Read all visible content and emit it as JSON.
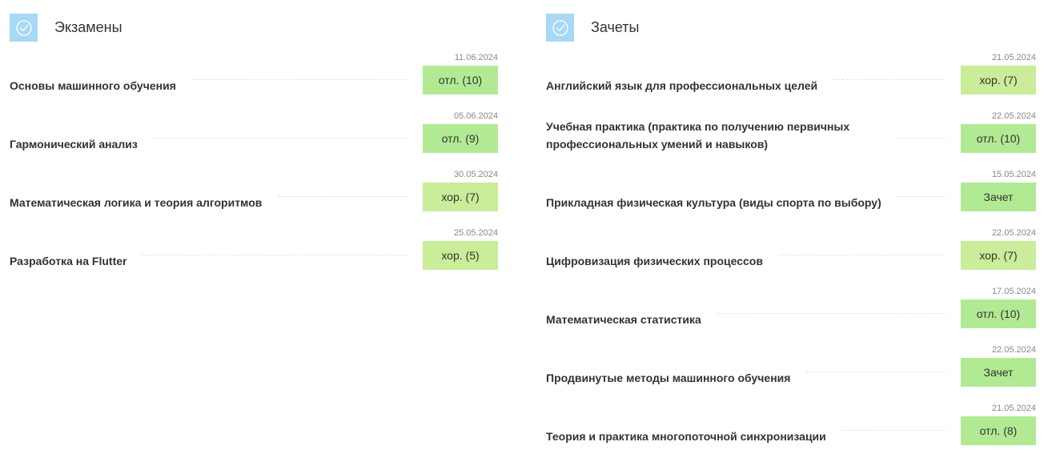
{
  "exams": {
    "title": "Экзамены",
    "items": [
      {
        "subject": "Основы машинного обучения",
        "date": "11.06.2024",
        "grade": "отл. (10)",
        "kind": "excellent"
      },
      {
        "subject": "Гармонический анализ",
        "date": "05.06.2024",
        "grade": "отл. (9)",
        "kind": "excellent"
      },
      {
        "subject": "Математическая логика и теория алгоритмов",
        "date": "30.05.2024",
        "grade": "хор. (7)",
        "kind": "good"
      },
      {
        "subject": "Разработка на Flutter",
        "date": "25.05.2024",
        "grade": "хор. (5)",
        "kind": "good"
      }
    ]
  },
  "credits": {
    "title": "Зачеты",
    "items": [
      {
        "subject": "Английский язык для профессиональных целей",
        "date": "21.05.2024",
        "grade": "хор. (7)",
        "kind": "good"
      },
      {
        "subject": "Учебная практика (практика по получению первичных профессиональных умений и навыков)",
        "date": "22.05.2024",
        "grade": "отл. (10)",
        "kind": "excellent"
      },
      {
        "subject": "Прикладная физическая культура (виды спорта по выбору)",
        "date": "15.05.2024",
        "grade": "Зачет",
        "kind": "pass"
      },
      {
        "subject": "Цифровизация физических процессов",
        "date": "22.05.2024",
        "grade": "хор. (7)",
        "kind": "good"
      },
      {
        "subject": "Математическая статистика",
        "date": "17.05.2024",
        "grade": "отл. (10)",
        "kind": "excellent"
      },
      {
        "subject": "Продвинутые методы машинного обучения",
        "date": "22.05.2024",
        "grade": "Зачет",
        "kind": "pass"
      },
      {
        "subject": "Теория и практика многопоточной синхронизации",
        "date": "21.05.2024",
        "grade": "отл. (8)",
        "kind": "excellent"
      }
    ]
  },
  "colors": {
    "icon_bg": "#a9d8f7",
    "excellent": "#b1ea93",
    "good": "#c9ed98",
    "pass": "#b1ea93"
  },
  "icons": {
    "header_icon": "check-circle-icon"
  }
}
